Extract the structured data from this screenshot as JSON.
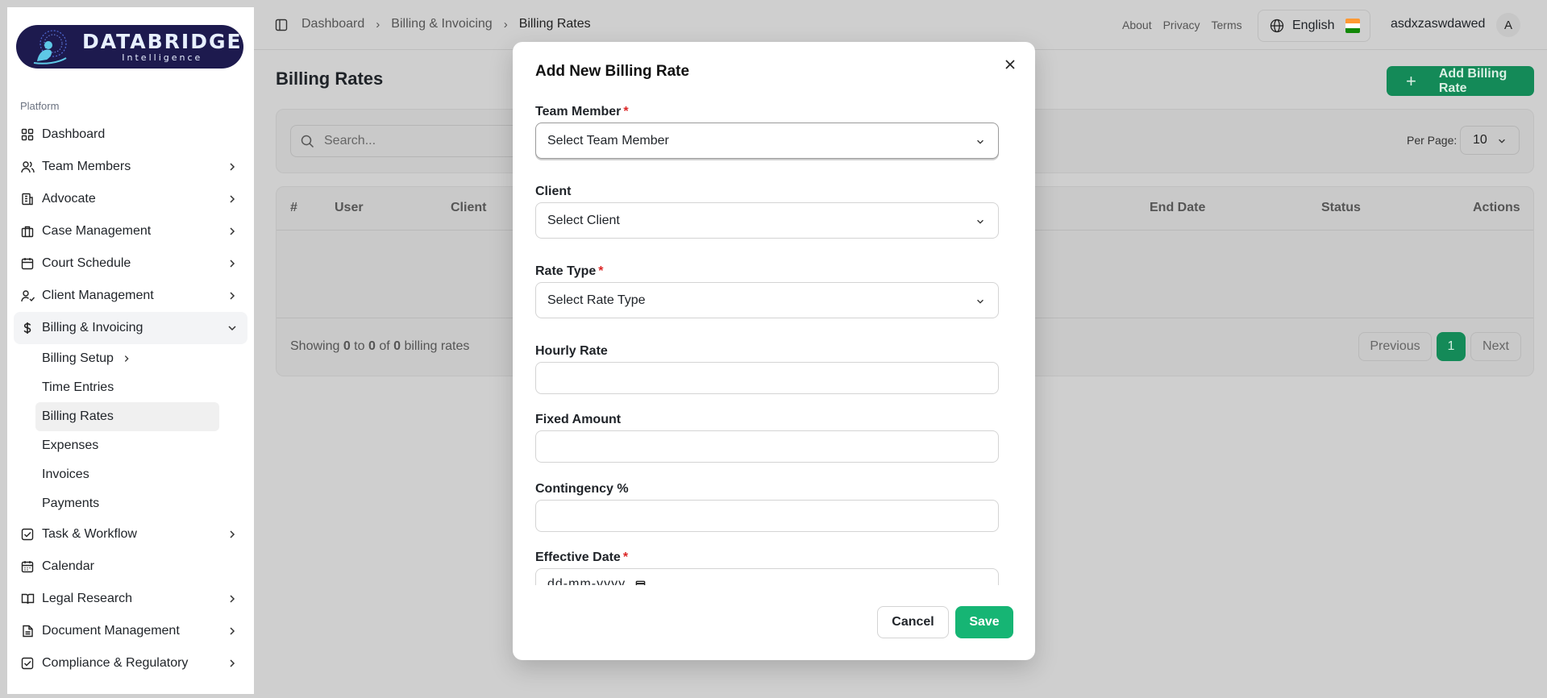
{
  "brand": {
    "name": "DATABRIDGE",
    "tagline": "Intelligence"
  },
  "sidebar": {
    "section_label": "Platform",
    "items": [
      {
        "label": "Dashboard",
        "icon": "grid-icon",
        "has_children": false
      },
      {
        "label": "Team Members",
        "icon": "users-icon",
        "has_children": true
      },
      {
        "label": "Advocate",
        "icon": "building-icon",
        "has_children": true
      },
      {
        "label": "Case Management",
        "icon": "briefcase-icon",
        "has_children": true
      },
      {
        "label": "Court Schedule",
        "icon": "calendar-icon",
        "has_children": true
      },
      {
        "label": "Client Management",
        "icon": "user-check-icon",
        "has_children": true
      },
      {
        "label": "Billing & Invoicing",
        "icon": "dollar-icon",
        "has_children": true,
        "expanded": true
      },
      {
        "label": "Task & Workflow",
        "icon": "checkbox-icon",
        "has_children": true
      },
      {
        "label": "Calendar",
        "icon": "calendar-icon",
        "has_children": false
      },
      {
        "label": "Legal Research",
        "icon": "book-icon",
        "has_children": true
      },
      {
        "label": "Document Management",
        "icon": "file-icon",
        "has_children": true
      },
      {
        "label": "Compliance & Regulatory",
        "icon": "checkbox-icon",
        "has_children": true
      }
    ],
    "billing_sub": [
      {
        "label": "Billing Setup"
      },
      {
        "label": "Time Entries"
      },
      {
        "label": "Billing Rates",
        "active": true
      },
      {
        "label": "Expenses"
      },
      {
        "label": "Invoices"
      },
      {
        "label": "Payments"
      }
    ]
  },
  "topbar": {
    "breadcrumb": [
      "Dashboard",
      "Billing & Invoicing",
      "Billing Rates"
    ],
    "links": [
      "About",
      "Privacy",
      "Terms"
    ],
    "language": "English",
    "username": "asdxzaswdawed",
    "avatar_initial": "A"
  },
  "page": {
    "title": "Billing Rates",
    "add_button": "Add Billing Rate",
    "search_placeholder": "Search...",
    "per_page_label": "Per Page:",
    "per_page_value": "10",
    "columns": [
      "#",
      "User",
      "Client",
      "End Date",
      "Status",
      "Actions"
    ],
    "showing": {
      "prefix": "Showing ",
      "from": "0",
      "to_word": " to ",
      "to": "0",
      "of_word": " of ",
      "total": "0",
      "suffix": " billing rates"
    },
    "pagination": {
      "previous": "Previous",
      "current": "1",
      "next": "Next"
    }
  },
  "modal": {
    "title": "Add New Billing Rate",
    "fields": {
      "team_member": {
        "label": "Team Member",
        "value": "Select Team Member",
        "required": "*"
      },
      "client": {
        "label": "Client",
        "value": "Select Client"
      },
      "rate_type": {
        "label": "Rate Type",
        "value": "Select Rate Type",
        "required": "*"
      },
      "hourly_rate": {
        "label": "Hourly Rate",
        "value": ""
      },
      "fixed_amount": {
        "label": "Fixed Amount",
        "value": ""
      },
      "contingency": {
        "label": "Contingency %",
        "value": ""
      },
      "effective_date": {
        "label": "Effective Date",
        "value": "dd-mm-yyyy",
        "required": "*"
      }
    },
    "cancel": "Cancel",
    "save": "Save"
  },
  "colors": {
    "accent": "#16b574",
    "accent_dim": "#148a58",
    "brand_bg": "#1d1a4e",
    "required": "#dc2626"
  }
}
